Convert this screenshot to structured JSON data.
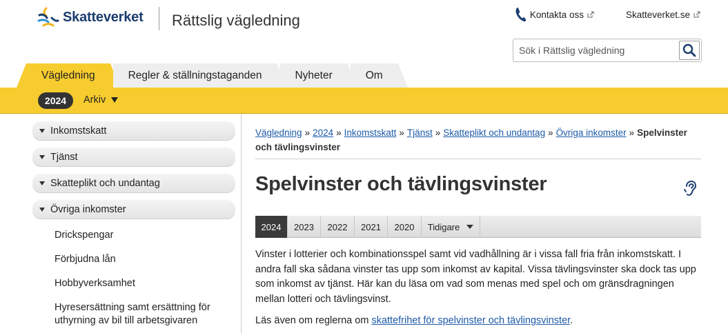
{
  "header": {
    "logo_text": "Skatteverket",
    "site_title": "Rättslig vägledning",
    "contact_label": "Kontakta oss",
    "external_site_label": "Skatteverket.se",
    "search_placeholder": "Sök i Rättslig vägledning"
  },
  "tabs": [
    {
      "label": "Vägledning",
      "active": true
    },
    {
      "label": "Regler & ställningstaganden",
      "active": false
    },
    {
      "label": "Nyheter",
      "active": false
    },
    {
      "label": "Om",
      "active": false
    }
  ],
  "subnav": {
    "year": "2024",
    "archive_label": "Arkiv"
  },
  "sidebar": {
    "items": [
      {
        "label": "Inkomstskatt"
      },
      {
        "label": "Tjänst"
      },
      {
        "label": "Skatteplikt och undantag"
      },
      {
        "label": "Övriga inkomster"
      }
    ],
    "sub_items": [
      {
        "label": "Drickspengar"
      },
      {
        "label": "Förbjudna lån"
      },
      {
        "label": "Hobbyverksamhet"
      },
      {
        "label": "Hyresersättning samt ersättning för uthyrning av bil till arbetsgivaren"
      }
    ]
  },
  "breadcrumb": {
    "links": [
      "Vägledning",
      "2024",
      "Inkomstskatt",
      "Tjänst",
      "Skatteplikt och undantag",
      "Övriga inkomster"
    ],
    "separator": "»",
    "current": "Spelvinster och tävlingsvinster"
  },
  "main": {
    "title": "Spelvinster och tävlingsvinster",
    "year_tabs": [
      {
        "label": "2024",
        "active": true
      },
      {
        "label": "2023",
        "active": false
      },
      {
        "label": "2022",
        "active": false
      },
      {
        "label": "2021",
        "active": false
      },
      {
        "label": "2020",
        "active": false
      },
      {
        "label": "Tidigare",
        "active": false
      }
    ],
    "paragraph1": "Vinster i lotterier och kombinationsspel samt vid vadhållning är i vissa fall fria från inkomstskatt. I andra fall ska sådana vinster tas upp som inkomst av kapital. Vissa tävlingsvinster ska dock tas upp som inkomst av tjänst. Här kan du läsa om vad som menas med spel och om gränsdragningen mellan lotteri och tävlingsvinst.",
    "paragraph2_prefix": "Läs även om reglerna om ",
    "paragraph2_link": "skattefrihet för spelvinster och tävlingsvinster",
    "paragraph2_suffix": "."
  },
  "colors": {
    "brand_yellow": "#f7cc2e",
    "brand_blue": "#1b3d6e",
    "link_blue": "#1d5aa8"
  },
  "icons": [
    "skatteverket-logo-icon",
    "phone-icon",
    "external-link-icon",
    "search-icon",
    "caret-down-icon",
    "listen-icon"
  ]
}
